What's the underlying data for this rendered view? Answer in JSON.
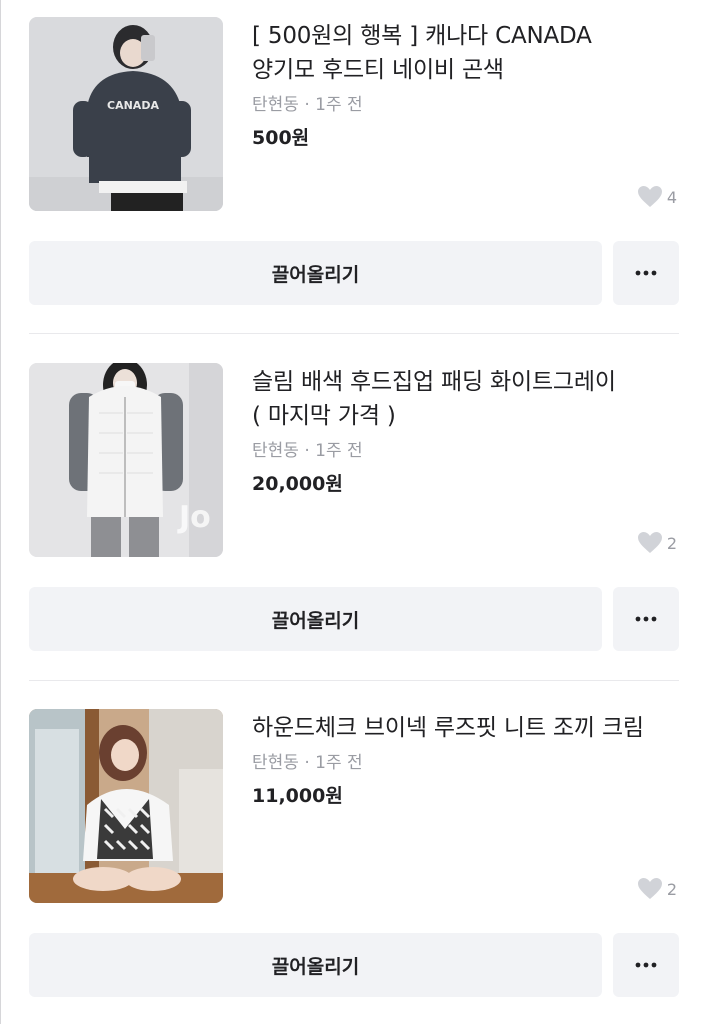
{
  "listings": [
    {
      "title_line1": "[ 500원의 행복 ] 캐나다 CANADA",
      "title_line2": "양기모 후드티 네이비 곤색",
      "location": "탄현동",
      "time": "1주 전",
      "price": "500원",
      "likes": "4",
      "bump_label": "끌어올리기",
      "image_print": "CANADA"
    },
    {
      "title_line1": "슬림 배색 후드집업 패딩 화이트그레이",
      "title_line2": "( 마지막 가격 )",
      "location": "탄현동",
      "time": "1주 전",
      "price": "20,000원",
      "likes": "2",
      "bump_label": "끌어올리기",
      "image_watermark": "Jo"
    },
    {
      "title_line1": "하운드체크 브이넥 루즈핏 니트 조끼 크림",
      "title_line2": "",
      "location": "탄현동",
      "time": "1주 전",
      "price": "11,000원",
      "likes": "2",
      "bump_label": "끌어올리기"
    }
  ],
  "meta_separator": "·",
  "icons": {
    "like": "heart-icon",
    "more": "more-dots-icon"
  },
  "colors": {
    "text": "#212124",
    "muted": "#9a9ca3",
    "button_bg": "#f2f3f6",
    "divider": "#e9e9ec"
  }
}
